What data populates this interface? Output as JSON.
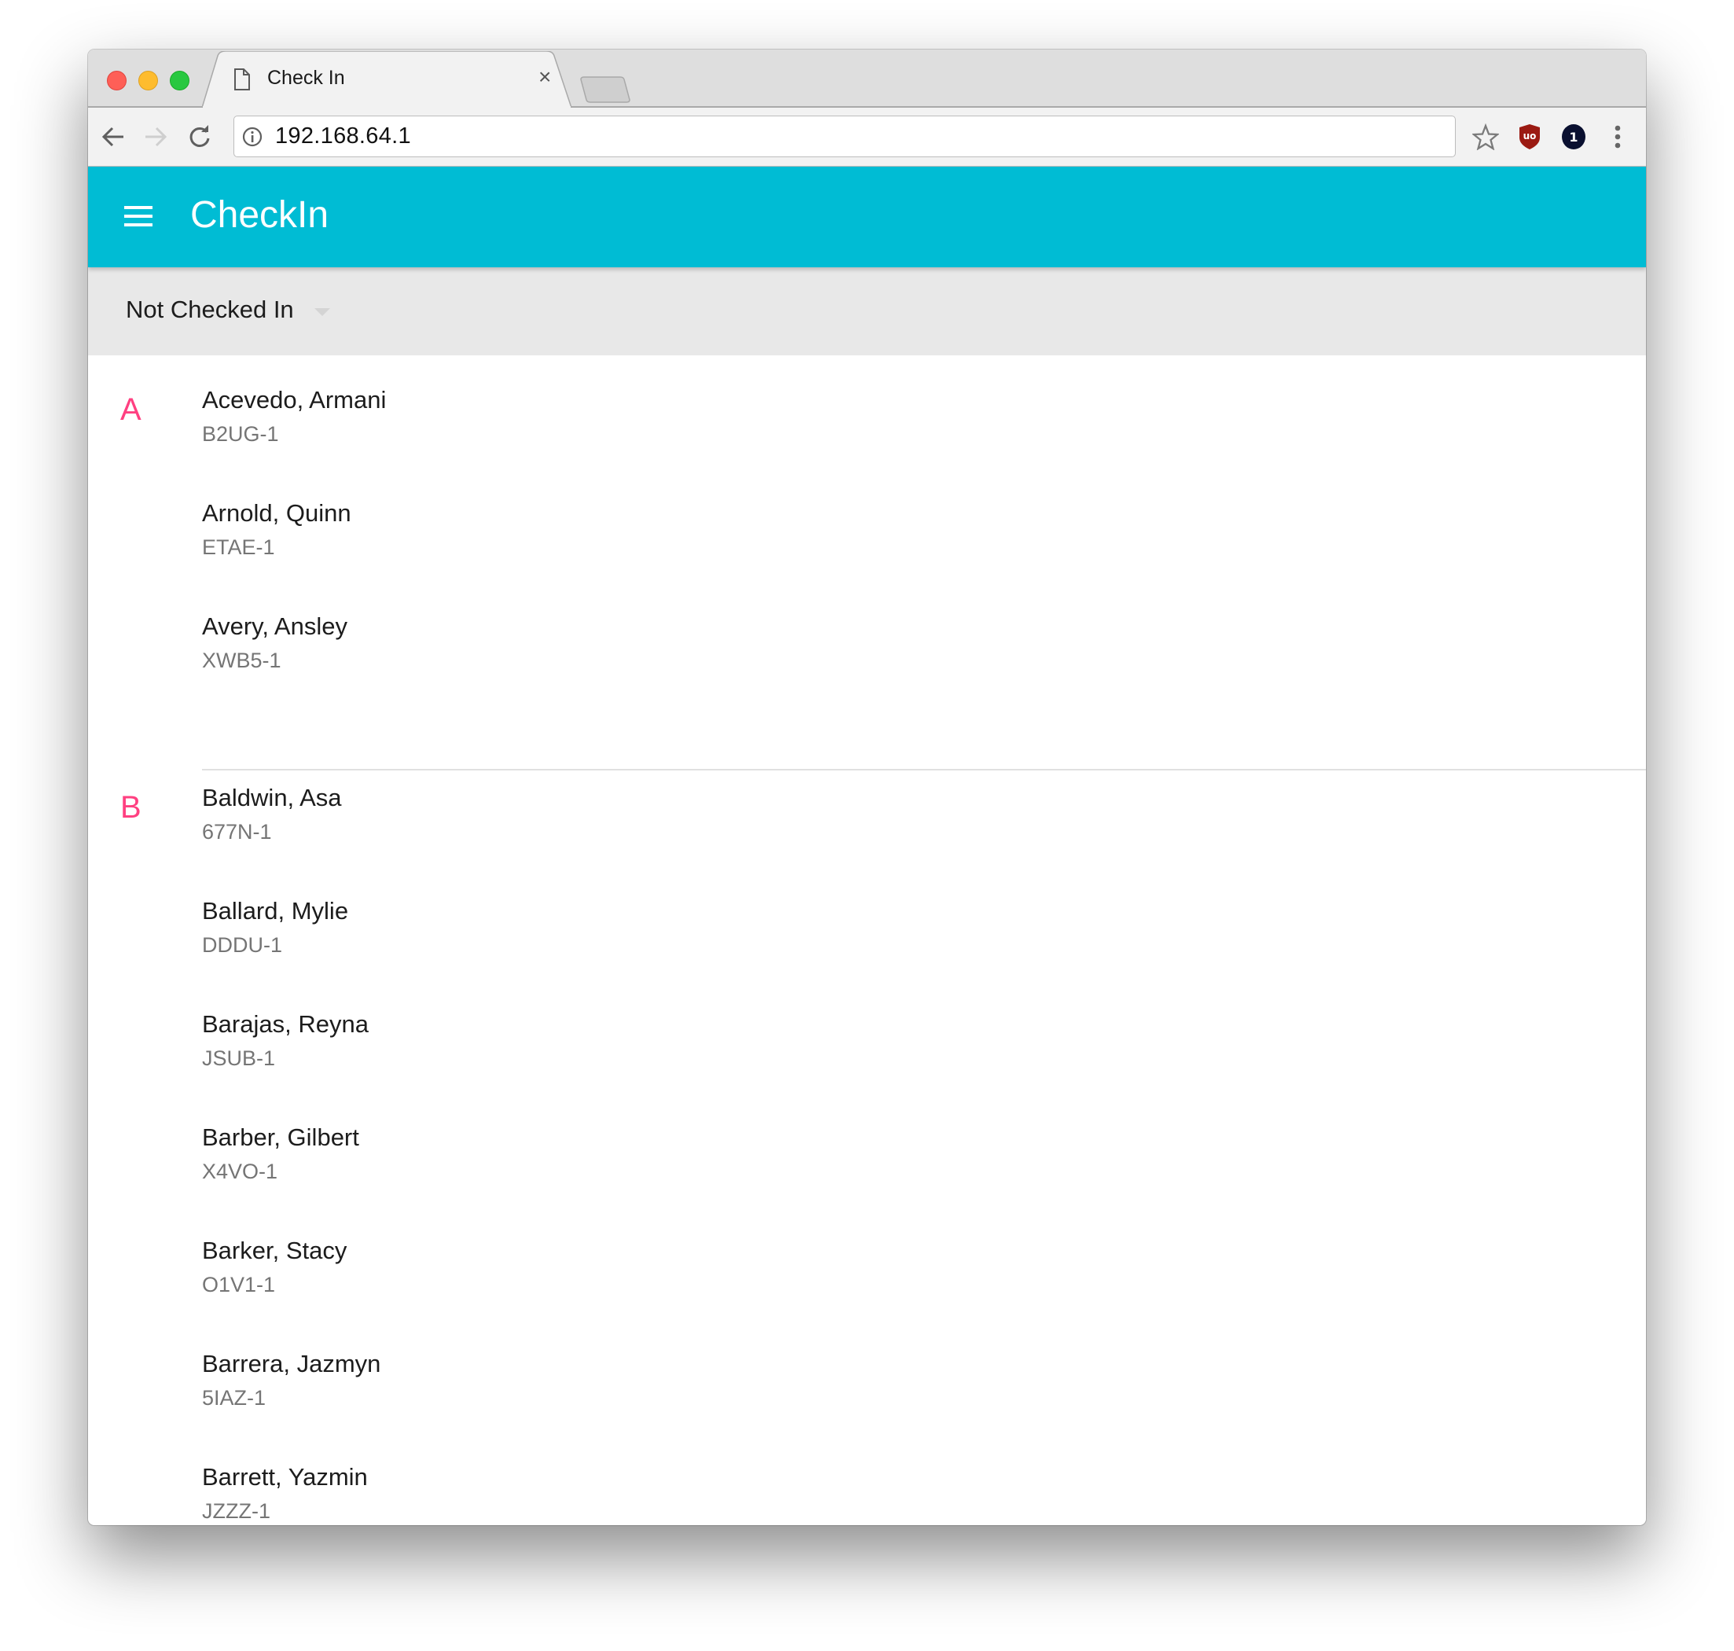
{
  "browser": {
    "tab_title": "Check In",
    "tab_close": "×",
    "url": "192.168.64.1",
    "icons": {
      "back": "arrow-left-icon",
      "forward": "arrow-right-icon",
      "reload": "reload-icon",
      "site_info": "info-icon",
      "bookmark": "star-icon",
      "ublock": "ublock-origin-icon",
      "onepassword": "onepassword-icon",
      "menu": "kebab-menu-icon"
    },
    "onepassword_badge": "1",
    "ublock_label": "uo"
  },
  "app": {
    "title": "CheckIn",
    "accent_color": "#00bcd4",
    "letter_color": "#ff4081"
  },
  "filter": {
    "selected": "Not Checked In"
  },
  "sections": [
    {
      "letter": "A",
      "people": [
        {
          "name": "Acevedo, Armani",
          "code": "B2UG-1"
        },
        {
          "name": "Arnold, Quinn",
          "code": "ETAE-1"
        },
        {
          "name": "Avery, Ansley",
          "code": "XWB5-1"
        }
      ]
    },
    {
      "letter": "B",
      "people": [
        {
          "name": "Baldwin, Asa",
          "code": "677N-1"
        },
        {
          "name": "Ballard, Mylie",
          "code": "DDDU-1"
        },
        {
          "name": "Barajas, Reyna",
          "code": "JSUB-1"
        },
        {
          "name": "Barber, Gilbert",
          "code": "X4VO-1"
        },
        {
          "name": "Barker, Stacy",
          "code": "O1V1-1"
        },
        {
          "name": "Barrera, Jazmyn",
          "code": "5IAZ-1"
        },
        {
          "name": "Barrett, Yazmin",
          "code": "JZZZ-1"
        }
      ]
    }
  ]
}
